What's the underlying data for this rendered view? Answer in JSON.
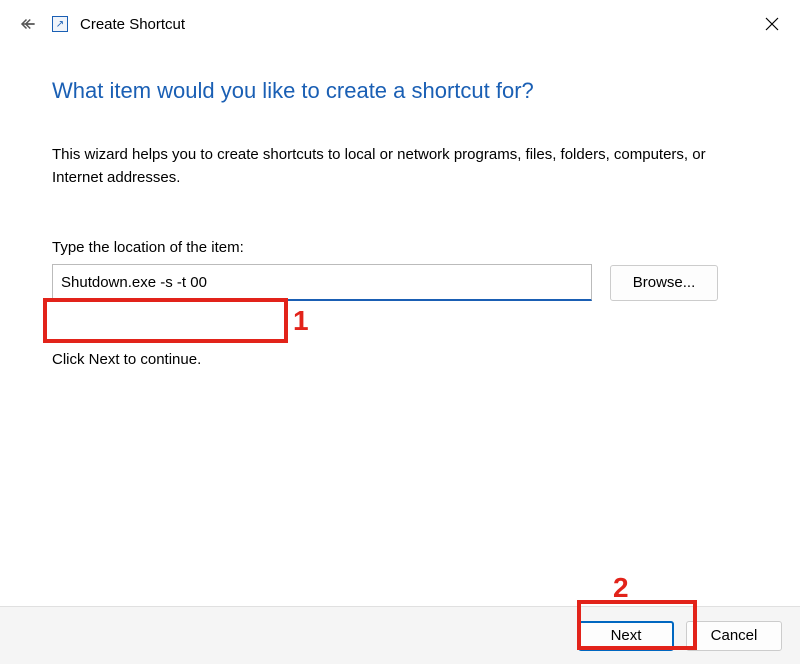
{
  "header": {
    "title": "Create Shortcut"
  },
  "main": {
    "heading": "What item would you like to create a shortcut for?",
    "description": "This wizard helps you to create shortcuts to local or network programs, files, folders, computers, or Internet addresses.",
    "location_label": "Type the location of the item:",
    "location_value": "Shutdown.exe -s -t 00",
    "browse_label": "Browse...",
    "continue_text": "Click Next to continue."
  },
  "footer": {
    "next_label": "Next",
    "cancel_label": "Cancel"
  },
  "annotations": {
    "label1": "1",
    "label2": "2"
  }
}
